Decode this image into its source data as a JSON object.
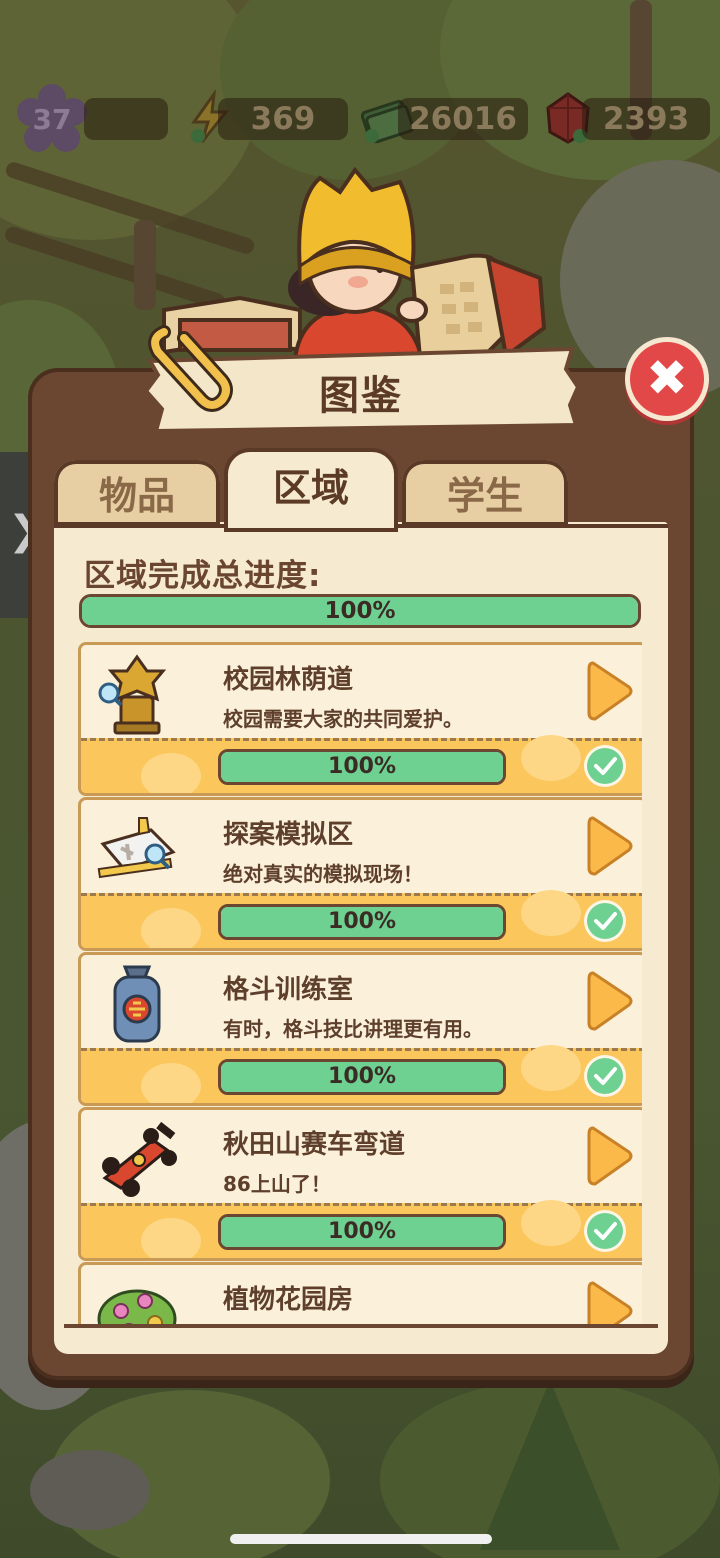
{
  "stats": {
    "level": "37",
    "energy": "369",
    "cash": "26016",
    "gems": "2393"
  },
  "side_tab_glyph": "❯",
  "dialog": {
    "title": "图鉴",
    "close_glyph": "✖",
    "tabs": [
      {
        "label": "物品",
        "active": false
      },
      {
        "label": "区域",
        "active": true
      },
      {
        "label": "学生",
        "active": false
      }
    ],
    "overall": {
      "label": "区域完成总进度:",
      "progress": 1.0,
      "progress_text": "100%"
    },
    "zones": [
      {
        "name": "校园林荫道",
        "desc": "校园需要大家的共同爱护。",
        "progress": 1.0,
        "progress_text": "100%",
        "icon": "golden-statue-icon",
        "complete": true
      },
      {
        "name": "探案模拟区",
        "desc": "绝对真实的模拟现场！",
        "progress": 1.0,
        "progress_text": "100%",
        "icon": "crime-scene-icon",
        "complete": true
      },
      {
        "name": "格斗训练室",
        "desc": "有时，格斗技比讲理更有用。",
        "progress": 1.0,
        "progress_text": "100%",
        "icon": "punching-bag-icon",
        "complete": true
      },
      {
        "name": "秋田山赛车弯道",
        "desc": "86上山了！",
        "progress": 1.0,
        "progress_text": "100%",
        "icon": "race-car-icon",
        "complete": true
      },
      {
        "name": "植物花园房",
        "desc": "",
        "progress": null,
        "progress_text": "",
        "icon": "flower-bush-icon",
        "complete": false
      }
    ]
  },
  "colors": {
    "panel": "#6b4631",
    "panel_inner": "#f6ead1",
    "progress_fill": "#6ed192",
    "card_lower": "#fbc75c",
    "arrow": "#fbb94a",
    "close": "#e24848"
  }
}
